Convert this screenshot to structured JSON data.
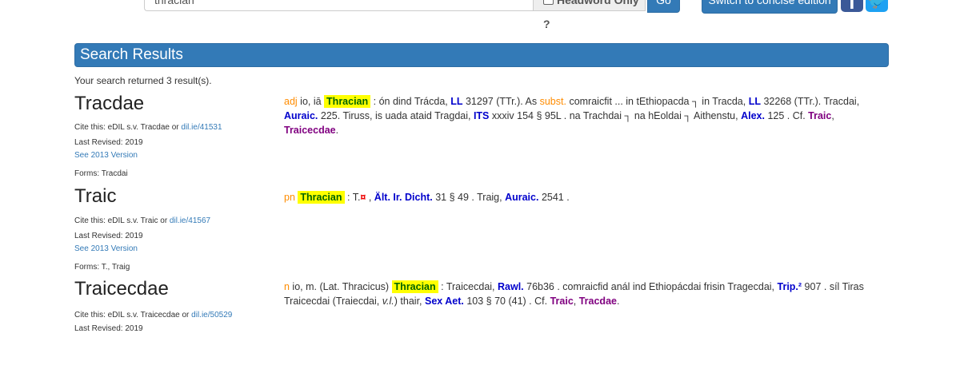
{
  "topbar": {
    "search_value": "thracian",
    "headword_only_label": "Headword Only ?",
    "go_label": "Go",
    "concise_label": "Switch to concise edition",
    "facebook_icon": "f",
    "twitter_icon": "🐦"
  },
  "panel": {
    "title": "Search Results",
    "result_count": "Your search returned 3 result(s)."
  },
  "entries": [
    {
      "headword": "Tracdae",
      "cite_prefix": "Cite this: eDIL s.v. Tracdae or ",
      "cite_link": "dil.ie/41531",
      "last_revised": "Last Revised: 2019",
      "see_2013": "See 2013 Version",
      "forms": "Forms: Tracdai",
      "pos": "adj",
      "t1": " io, iā ",
      "highlight": "Thracian",
      "t2": " : ón dind Trácda, ",
      "a1": "LL",
      "t3": " 31297 (TTr.). As ",
      "subst": "subst.",
      "t4": " comraicfit ... in tEthiopacda ┐ in Tracda, ",
      "a2": "LL",
      "t5": " 32268 (TTr.). Tracdai,",
      "a3": "Auraic.",
      "t6": " 225. Tiruss, is uada ataid Tragdai, ",
      "a4": "ITS",
      "t7": " xxxiv 154 § 95L . na Trachdai ┐ na hEoldai ┐ Aithenstu, ",
      "a5": "Alex.",
      "t8": " 125 . Cf. ",
      "x1": "Traic",
      "t9": ",",
      "x2": "Traicecdae",
      "t10": "."
    },
    {
      "headword": "Traic",
      "cite_prefix": "Cite this: eDIL s.v. Traic or ",
      "cite_link": "dil.ie/41567",
      "last_revised": "Last Revised: 2019",
      "see_2013": "See 2013 Version",
      "forms": "Forms: T., Traig",
      "pos": "pn",
      "highlight": "Thracian",
      "t1": " : T.",
      "t2": " , ",
      "a1": "Ält. Ir. Dicht.",
      "t3": " 31 § 49 . Traig, ",
      "a2": "Auraic.",
      "t4": " 2541 ."
    },
    {
      "headword": "Traicecdae",
      "cite_prefix": "Cite this: eDIL s.v. Traicecdae or ",
      "cite_link": "dil.ie/50529",
      "last_revised": "Last Revised: 2019",
      "pos": "n",
      "t1": " io, m. (Lat. Thracicus) ",
      "highlight": "Thracian",
      "t2": " : Traicecdai, ",
      "a1": "Rawl.",
      "t3": " 76b36 . comraicfid anál ind Ethiopácdai frisin Tragecdai, ",
      "a2": "Trip.²",
      "t4": " 907 . síl Tiras",
      "t5": "Traicecdai (Traiecdai, ",
      "vl": "v.l.",
      "t6": ") thair, ",
      "a3": "Sex Aet.",
      "t7": " 103 § 70 (41) . Cf. ",
      "x1": "Traic",
      "t8": ", ",
      "x2": "Tracdae",
      "t9": "."
    }
  ]
}
